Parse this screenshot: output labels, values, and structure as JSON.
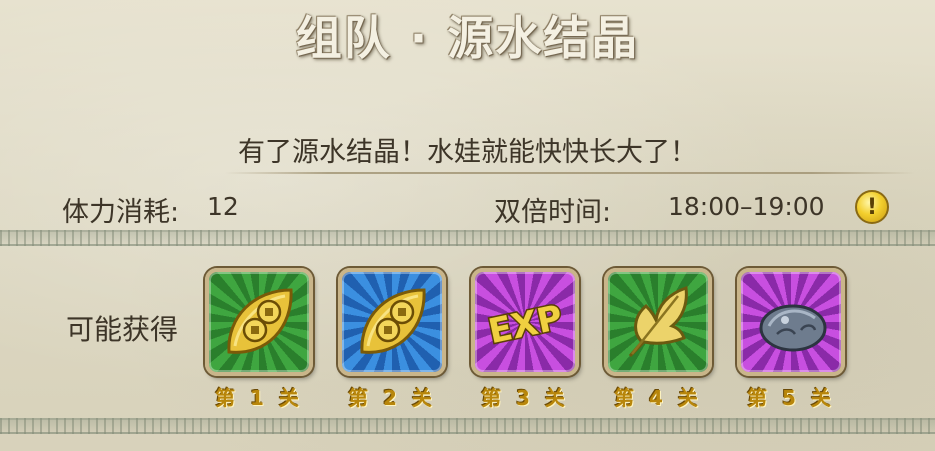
{
  "title": "组队 · 源水结晶",
  "subtitle": "有了源水结晶！水娃就能快快长大了！",
  "stamina": {
    "label": "体力消耗:",
    "value": "12"
  },
  "double_time": {
    "label": "双倍时间:",
    "value": "18:00–19:00"
  },
  "info_button": {
    "icon": "exclamation-icon"
  },
  "rewards": {
    "label": "可能获得",
    "items": [
      {
        "icon": "gold-coin-leaf-icon",
        "frame_color": "#2a7f2c",
        "stage": "第 1 关"
      },
      {
        "icon": "gold-coin-leaf-icon",
        "frame_color": "#2060b0",
        "stage": "第 2 关"
      },
      {
        "icon": "exp-icon",
        "frame_color": "#8a2aa8",
        "stage": "第 3 关"
      },
      {
        "icon": "golden-leaf-icon",
        "frame_color": "#2a7f2c",
        "stage": "第 4 关"
      },
      {
        "icon": "ore-stone-icon",
        "frame_color": "#8a2aa8",
        "stage": "第 5 关"
      }
    ]
  }
}
